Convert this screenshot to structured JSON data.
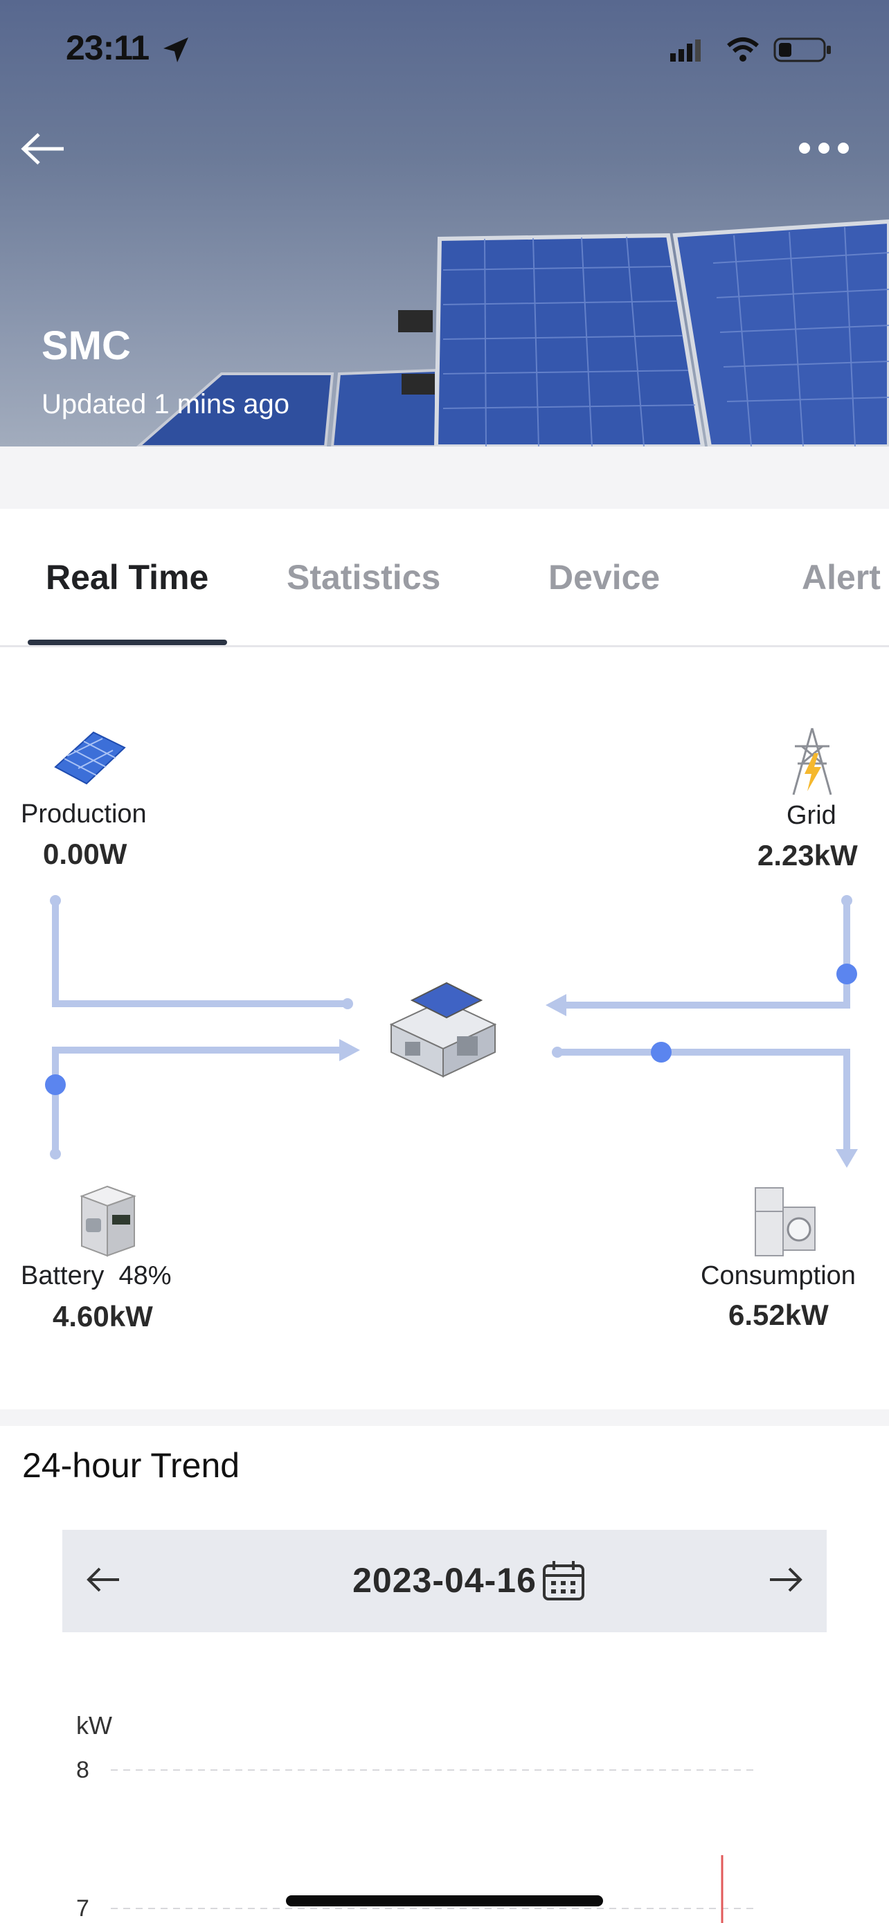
{
  "status_bar": {
    "time": "23:11"
  },
  "hero": {
    "title": "SMC",
    "subtitle": "Updated 1 mins ago"
  },
  "tabs": [
    {
      "label": "Real Time",
      "active": true
    },
    {
      "label": "Statistics"
    },
    {
      "label": "Device"
    },
    {
      "label": "Alert"
    }
  ],
  "flow": {
    "production": {
      "label": "Production",
      "value": "0.00W"
    },
    "grid": {
      "label": "Grid",
      "value": "2.23kW"
    },
    "battery": {
      "label": "Battery",
      "percent": "48%",
      "value": "4.60kW"
    },
    "consumption": {
      "label": "Consumption",
      "value": "6.52kW"
    }
  },
  "trend": {
    "title": "24-hour Trend",
    "date": "2023-04-16",
    "unit": "kW",
    "ticks": [
      "8",
      "7"
    ]
  },
  "colors": {
    "flow_line": "#b7c6ea",
    "flow_dot": "#5b85ef",
    "tab_active": "#2b3444"
  }
}
